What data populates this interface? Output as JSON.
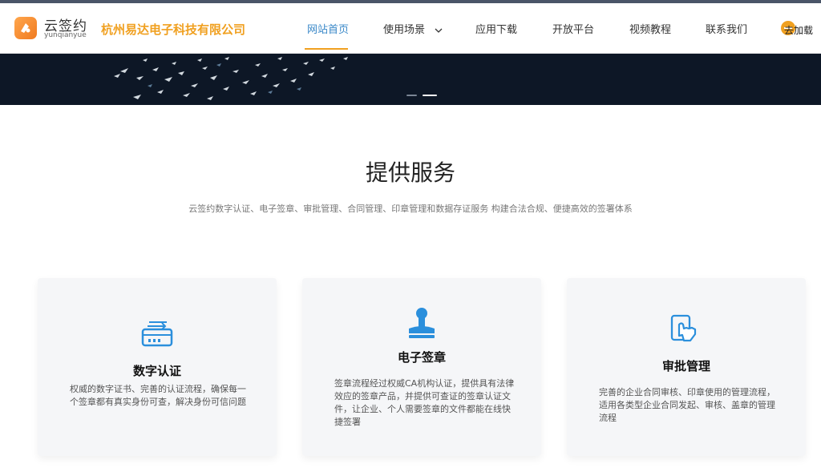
{
  "header": {
    "brand_name": "云签约",
    "brand_sub": "yunqianyue",
    "company": "杭州易达电子科技有限公司",
    "login_text": "去加载"
  },
  "nav": [
    {
      "label": "网站首页"
    },
    {
      "label": "使用场景"
    },
    {
      "label": "应用下载"
    },
    {
      "label": "开放平台"
    },
    {
      "label": "视频教程"
    },
    {
      "label": "联系我们"
    }
  ],
  "section": {
    "title": "提供服务",
    "subtitle": "云签约数字认证、电子签章、审批管理、合同管理、印章管理和数据存证服务 构建合法合规、便捷高效的签署体系"
  },
  "cards": [
    {
      "title": "数字认证",
      "desc": "权威的数字证书、完善的认证流程，确保每一个签章都有真实身份可查，解决身份可信问题",
      "icon": "certificate-icon"
    },
    {
      "title": "电子签章",
      "desc": "签章流程经过权威CA机构认证，提供具有法律效应的签章产品，并提供可查证的签章认证文件，让企业、个人需要签章的文件都能在线快捷签署",
      "icon": "stamp-icon"
    },
    {
      "title": "审批管理",
      "desc": "完善的企业合同审核、印章使用的管理流程，适用各类型企业合同发起、审核、盖章的管理流程",
      "icon": "touch-approve-icon"
    }
  ],
  "colors": {
    "accent": "#f0a020",
    "active_nav": "#3a88c8",
    "icon_blue": "#2b8fdc",
    "banner_bg": "#0d1726"
  }
}
